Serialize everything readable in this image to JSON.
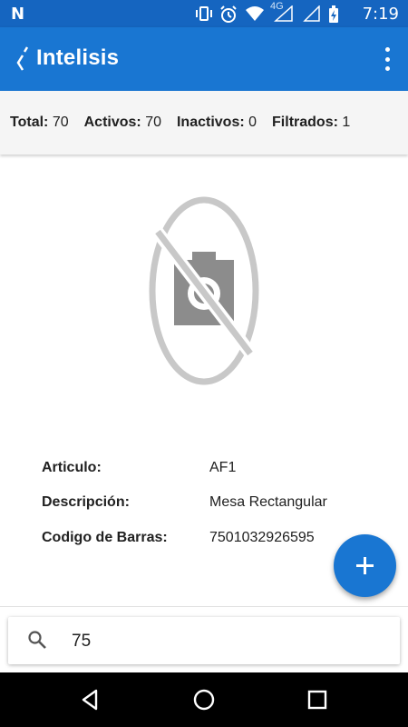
{
  "status_bar": {
    "time": "7:19",
    "network_label": "4G",
    "icons": [
      "notification-n-icon",
      "vibrate-icon",
      "alarm-icon",
      "wifi-icon",
      "signal-icon",
      "signal-icon",
      "battery-charging-icon"
    ]
  },
  "app_bar": {
    "title": "Intelisis",
    "logo_icon": "intelisis-logo-icon",
    "menu_icon": "more-vert-icon"
  },
  "stats": {
    "total_label": "Total:",
    "total_value": "70",
    "active_label": "Activos:",
    "active_value": "70",
    "inactive_label": "Inactivos:",
    "inactive_value": "0",
    "filtered_label": "Filtrados:",
    "filtered_value": "1"
  },
  "product": {
    "image_icon": "no-photo-icon",
    "article_label": "Articulo:",
    "article_value": "AF1",
    "description_label": "Descripción:",
    "description_value": "Mesa Rectangular",
    "barcode_label": "Codigo de Barras:",
    "barcode_value": "7501032926595"
  },
  "fab": {
    "icon": "add-icon"
  },
  "search": {
    "value": "75",
    "icon": "search-icon"
  },
  "nav": {
    "back_icon": "back-icon",
    "home_icon": "home-icon",
    "recents_icon": "recents-icon"
  },
  "colors": {
    "primary": "#1976D2",
    "primary_dark": "#1565C0",
    "stats_bg": "#f5f5f5"
  }
}
